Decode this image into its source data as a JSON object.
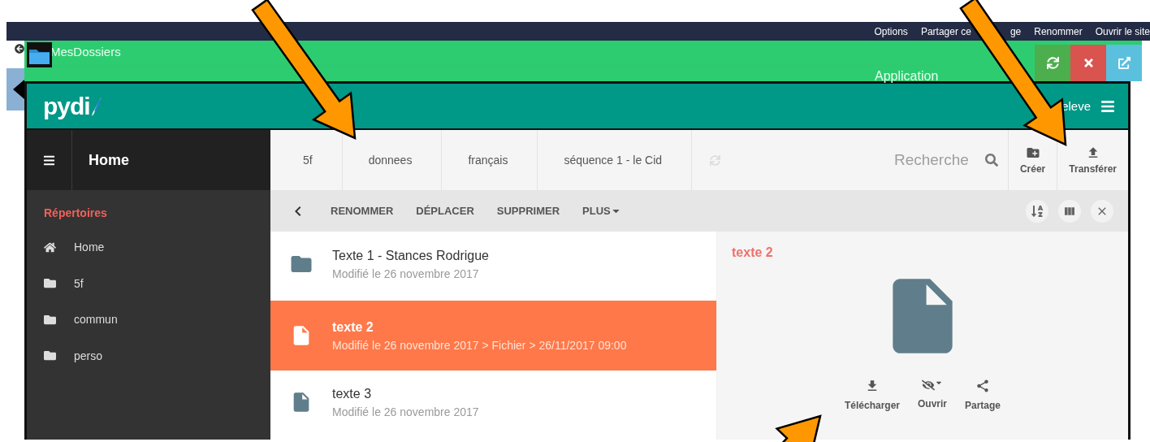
{
  "top_menu": [
    {
      "label": "Options",
      "kind": "link"
    },
    {
      "label": "Partager ce",
      "kind": "link"
    },
    {
      "label": "ge",
      "kind": "fragment"
    },
    {
      "label": "Renommer",
      "kind": "link"
    },
    {
      "label": "Ouvrir le site",
      "kind": "link"
    }
  ],
  "app_bar": {
    "title": "MesDossiers",
    "subtitle": "Application"
  },
  "header": {
    "logo": "pydi",
    "user": "eleve"
  },
  "sidebar": {
    "title": "Home",
    "section": "Répertoires",
    "items": [
      {
        "label": "Home",
        "kind": "home"
      },
      {
        "label": "5f",
        "kind": "folder"
      },
      {
        "label": "commun",
        "kind": "folder"
      },
      {
        "label": "perso",
        "kind": "folder"
      }
    ]
  },
  "breadcrumb": [
    "5f",
    "donnees",
    "français",
    "séquence 1 - le Cid"
  ],
  "search": {
    "placeholder": "Recherche"
  },
  "toolbar_buttons": [
    {
      "label": "Créer",
      "kind": "create"
    },
    {
      "label": "Transférer",
      "kind": "upload"
    }
  ],
  "actions": [
    "RENOMMER",
    "DÉPLACER",
    "SUPPRIMER",
    "PLUS"
  ],
  "files": [
    {
      "name": "Texte 1 - Stances Rodrigue",
      "details": "Modifié le 26 novembre 2017",
      "kind": "folder",
      "selected": false
    },
    {
      "name": "texte 2",
      "details": "Modifié le 26 novembre 2017 > Fichier > 26/11/2017 09:00",
      "kind": "file",
      "selected": true
    },
    {
      "name": "texte 3",
      "details": "Modifié le 26 novembre 2017",
      "kind": "file",
      "selected": false
    }
  ],
  "detail": {
    "title": "texte 2",
    "actions": [
      {
        "label": "Télécharger",
        "kind": "download"
      },
      {
        "label": "Ouvrir",
        "kind": "open"
      },
      {
        "label": "Partage",
        "kind": "share"
      }
    ]
  }
}
